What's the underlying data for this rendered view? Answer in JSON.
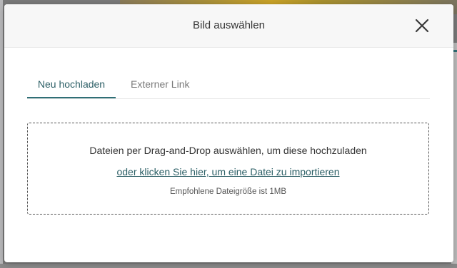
{
  "modal": {
    "title": "Bild auswählen",
    "close_icon": "close-icon"
  },
  "tabs": [
    {
      "label": "Neu hochladen",
      "active": true
    },
    {
      "label": "Externer Link",
      "active": false
    }
  ],
  "dropzone": {
    "title": "Dateien per Drag-and-Drop auswählen, um diese hochzuladen",
    "link_label": "oder klicken Sie hier, um eine Datei zu importieren",
    "hint": "Empfohlene Dateigröße ist 1MB"
  },
  "colors": {
    "accent": "#2f6f76",
    "header_bg": "#f7f7f7",
    "overlay": "#7a7a7a"
  }
}
